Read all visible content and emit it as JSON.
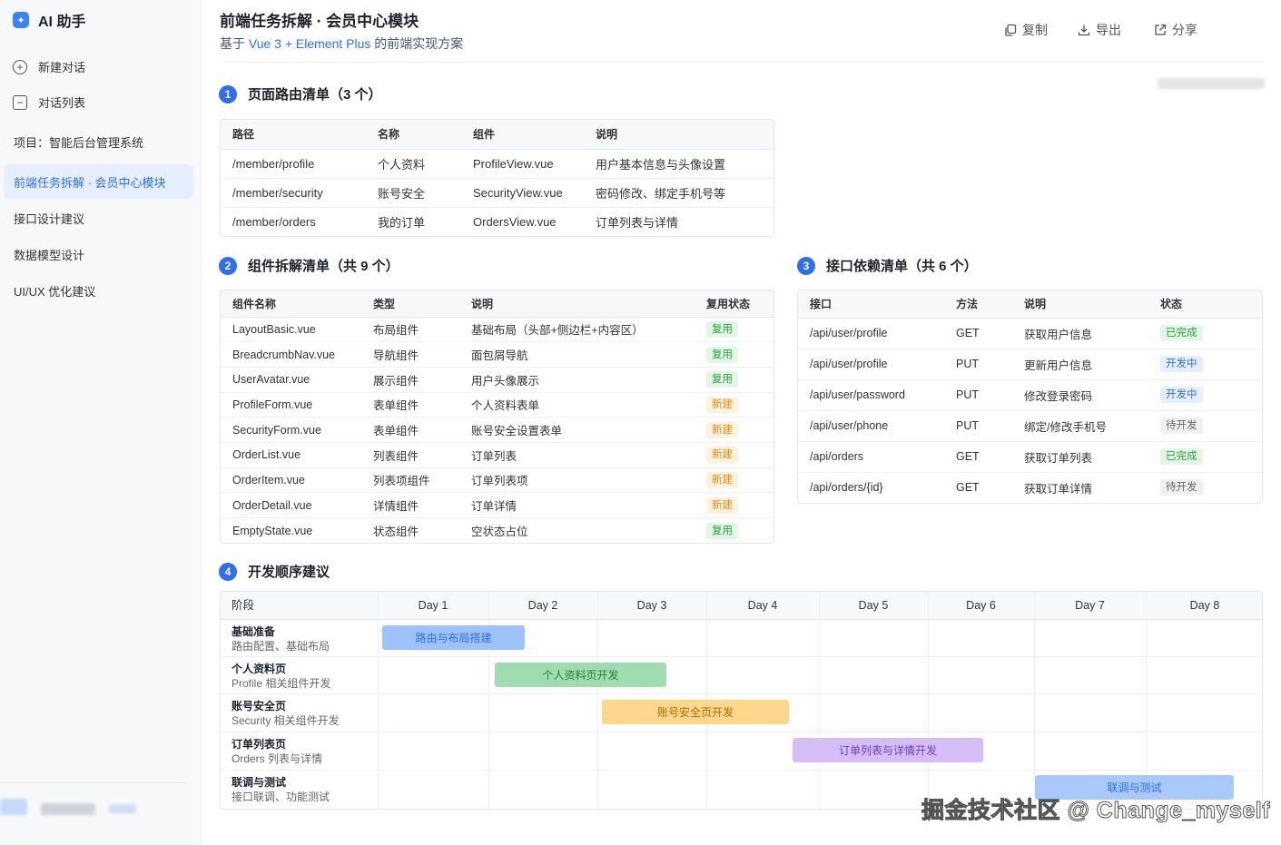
{
  "app": {
    "logo_glyph": "✦",
    "name": "AI 助手"
  },
  "sidebar": {
    "new_chat": "新建对话",
    "chat_list": "对话列表",
    "project": "项目：智能后台管理系统",
    "items": [
      {
        "label": "前端任务拆解 · 会员中心模块",
        "active": true
      },
      {
        "label": "接口设计建议"
      },
      {
        "label": "数据模型设计"
      },
      {
        "label": "UI/UX 优化建议"
      }
    ]
  },
  "header": {
    "title": "前端任务拆解 · 会员中心模块",
    "subtitle_prefix": "基于 ",
    "subtitle_highlight": "Vue 3 + Element Plus",
    "subtitle_suffix": " 的前端实现方案",
    "copy": "复制",
    "export": "导出",
    "share": "分享"
  },
  "routes": {
    "num": "1",
    "title": "页面路由清单（3 个）",
    "columns": [
      "路径",
      "名称",
      "组件",
      "说明"
    ],
    "rows": [
      [
        "/member/profile",
        "个人资料",
        "ProfileView.vue",
        "用户基本信息与头像设置"
      ],
      [
        "/member/security",
        "账号安全",
        "SecurityView.vue",
        "密码修改、绑定手机号等"
      ],
      [
        "/member/orders",
        "我的订单",
        "OrdersView.vue",
        "订单列表与详情"
      ]
    ]
  },
  "components": {
    "num": "2",
    "title": "组件拆解清单（共 9 个）",
    "columns": [
      "组件名称",
      "类型",
      "说明",
      "复用状态"
    ],
    "rows": [
      [
        "LayoutBasic.vue",
        "布局组件",
        "基础布局（头部+侧边栏+内容区）",
        "复用"
      ],
      [
        "BreadcrumbNav.vue",
        "导航组件",
        "面包屑导航",
        "复用"
      ],
      [
        "UserAvatar.vue",
        "展示组件",
        "用户头像展示",
        "复用"
      ],
      [
        "ProfileForm.vue",
        "表单组件",
        "个人资料表单",
        "新建"
      ],
      [
        "SecurityForm.vue",
        "表单组件",
        "账号安全设置表单",
        "新建"
      ],
      [
        "OrderList.vue",
        "列表组件",
        "订单列表",
        "新建"
      ],
      [
        "OrderItem.vue",
        "列表项组件",
        "订单列表项",
        "新建"
      ],
      [
        "OrderDetail.vue",
        "详情组件",
        "订单详情",
        "新建"
      ],
      [
        "EmptyState.vue",
        "状态组件",
        "空状态占位",
        "复用"
      ]
    ]
  },
  "apis": {
    "num": "3",
    "title": "接口依赖清单（共 6 个）",
    "columns": [
      "接口",
      "方法",
      "说明",
      "状态"
    ],
    "rows": [
      [
        "/api/user/profile",
        "GET",
        "获取用户信息",
        "已完成"
      ],
      [
        "/api/user/profile",
        "PUT",
        "更新用户信息",
        "开发中"
      ],
      [
        "/api/user/password",
        "PUT",
        "修改登录密码",
        "开发中"
      ],
      [
        "/api/user/phone",
        "PUT",
        "绑定/修改手机号",
        "待开发"
      ],
      [
        "/api/orders",
        "GET",
        "获取订单列表",
        "已完成"
      ],
      [
        "/api/orders/{id}",
        "GET",
        "获取订单详情",
        "待开发"
      ]
    ]
  },
  "plan": {
    "num": "4",
    "title": "开发顺序建议",
    "stage_header": "阶段",
    "days": [
      "Day 1",
      "Day 2",
      "Day 3",
      "Day 4",
      "Day 5",
      "Day 6",
      "Day 7",
      "Day 8"
    ],
    "stages": [
      {
        "name": "基础准备",
        "desc": "路由配置、基础布局",
        "task": "路由与布局搭建",
        "color": "#9ec2fb",
        "text_color": "#2f6fed"
      },
      {
        "name": "个人资料页",
        "desc": "Profile 相关组件开发",
        "task": "个人资料页开发",
        "color": "#9fdcb0",
        "text_color": "#2e7d3f"
      },
      {
        "name": "账号安全页",
        "desc": "Security 相关组件开发",
        "task": "账号安全页开发",
        "color": "#fbd88c",
        "text_color": "#b26a00"
      },
      {
        "name": "订单列表页",
        "desc": "Orders 列表与详情",
        "task": "订单列表与详情开发",
        "color": "#d5bdf7",
        "text_color": "#6b3fb8"
      },
      {
        "name": "联调与测试",
        "desc": "接口联调、功能测试",
        "task": "联调与测试",
        "color": "#a9c9fb",
        "text_color": "#2f6fed"
      }
    ]
  },
  "watermark": "掘金技术社区 @ Change_myself"
}
